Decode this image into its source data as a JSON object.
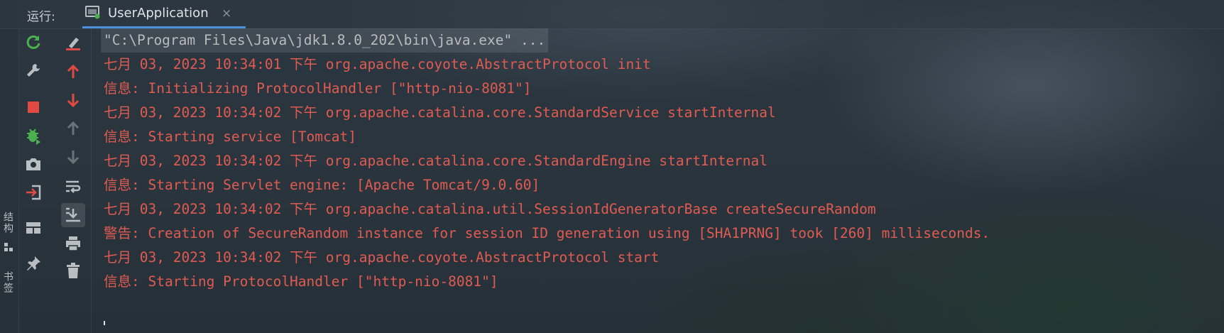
{
  "header": {
    "run_label": "运行:",
    "tab": {
      "title": "UserApplication",
      "close": "×",
      "icon": "run-config-icon"
    }
  },
  "side_labels": {
    "structure": "结构",
    "bookmarks": "书签"
  },
  "toolbar_left": [
    {
      "name": "rerun-button",
      "icon": "rerun-icon",
      "color": "#4caf50"
    },
    {
      "name": "settings-button",
      "icon": "wrench-icon",
      "color": "#b9bec3"
    },
    {
      "name": "stop-button",
      "icon": "stop-icon",
      "color": "#e04a42"
    },
    {
      "name": "debug-button",
      "icon": "debug-bug-icon",
      "color": "#4caf50"
    },
    {
      "name": "screenshot-button",
      "icon": "camera-icon",
      "color": "#b9bec3"
    },
    {
      "name": "restore-layout-button",
      "icon": "enter-icon",
      "color": "#b9bec3"
    },
    {
      "name": "layout-button",
      "icon": "layout-icon",
      "color": "#b9bec3"
    },
    {
      "name": "pin-button",
      "icon": "pin-icon",
      "color": "#b9bec3"
    }
  ],
  "toolbar_right": [
    {
      "name": "clear-button",
      "icon": "clear-icon",
      "color": "#e04a42"
    },
    {
      "name": "up-button",
      "icon": "arrow-up-icon",
      "color": "#e04a42"
    },
    {
      "name": "down-button",
      "icon": "arrow-down-icon",
      "color": "#e04a42"
    },
    {
      "name": "up-disabled",
      "icon": "arrow-up-icon",
      "color": "#6b737a"
    },
    {
      "name": "down-disabled",
      "icon": "arrow-down-icon",
      "color": "#6b737a"
    },
    {
      "name": "soft-wrap-button",
      "icon": "soft-wrap-icon",
      "color": "#b9bec3"
    },
    {
      "name": "scroll-to-end-button",
      "icon": "scroll-to-end-icon",
      "color": "#b9bec3"
    },
    {
      "name": "print-button",
      "icon": "printer-icon",
      "color": "#b9bec3"
    },
    {
      "name": "trash-button",
      "icon": "trash-icon",
      "color": "#b9bec3"
    }
  ],
  "console": {
    "lines": [
      "\"C:\\Program Files\\Java\\jdk1.8.0_202\\bin\\java.exe\" ...",
      "七月 03, 2023 10:34:01 下午 org.apache.coyote.AbstractProtocol init",
      "信息: Initializing ProtocolHandler [\"http-nio-8081\"]",
      "七月 03, 2023 10:34:02 下午 org.apache.catalina.core.StandardService startInternal",
      "信息: Starting service [Tomcat]",
      "七月 03, 2023 10:34:02 下午 org.apache.catalina.core.StandardEngine startInternal",
      "信息: Starting Servlet engine: [Apache Tomcat/9.0.60]",
      "七月 03, 2023 10:34:02 下午 org.apache.catalina.util.SessionIdGeneratorBase createSecureRandom",
      "警告: Creation of SecureRandom instance for session ID generation using [SHA1PRNG] took [260] milliseconds.",
      "七月 03, 2023 10:34:02 下午 org.apache.coyote.AbstractProtocol start",
      "信息: Starting ProtocolHandler [\"http-nio-8081\"]"
    ],
    "text_color": "#e05b52",
    "command_color": "#b8bcc0"
  }
}
